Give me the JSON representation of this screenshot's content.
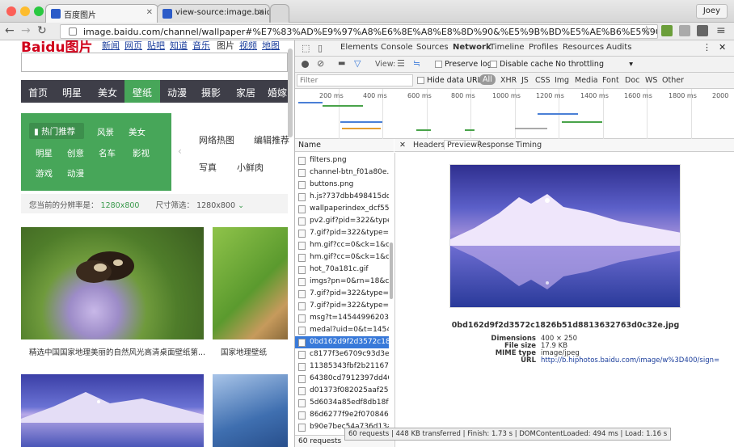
{
  "browser": {
    "tabs": [
      {
        "title": "百度图片"
      },
      {
        "title": "view-source:image.baidu.c"
      }
    ],
    "user_label": "Joey",
    "url": "image.baidu.com/channel/wallpaper#%E7%83%AD%E9%97%A8%E6%8E%A8%E8%8D%90&%E5%9B%BD%E5%AE%B6%E5%9C%B0%E7%90%86&..."
  },
  "page": {
    "logo": "Baidu图片",
    "top_links": [
      "新闻",
      "网页",
      "贴吧",
      "知道",
      "音乐",
      "图片",
      "视频",
      "地图"
    ],
    "categories": [
      "首页",
      "明星",
      "美女",
      "壁纸",
      "动漫",
      "摄影",
      "家居",
      "婚嫁"
    ],
    "active_category": "壁纸",
    "green_box": {
      "hot": "热门推荐",
      "items": [
        "风景",
        "美女",
        "明星",
        "创意",
        "名车",
        "影视",
        "游戏",
        "动漫"
      ]
    },
    "right_links": [
      "网络热图",
      "编辑推荐",
      "写真",
      "小鲜肉"
    ],
    "resolution_label": "您当前的分辨率是：",
    "resolution_value": "1280x800",
    "size_filter_label": "尺寸筛选：",
    "size_filter_value": "1280x800",
    "captions": [
      "精选中国国家地理美丽的自然风光高清桌面壁纸第...",
      "国家地理壁纸"
    ]
  },
  "devtools": {
    "tabs": [
      "Elements",
      "Console",
      "Sources",
      "Network",
      "Timeline",
      "Profiles",
      "Resources",
      "Audits"
    ],
    "active_tab": "Network",
    "toolbar": {
      "view_label": "View:",
      "preserve_log": "Preserve log",
      "disable_cache": "Disable cache",
      "throttling": "No throttling"
    },
    "filter": {
      "placeholder": "Filter",
      "hide_data_urls": "Hide data URLs",
      "types": [
        "All",
        "XHR",
        "JS",
        "CSS",
        "Img",
        "Media",
        "Font",
        "Doc",
        "WS",
        "Other"
      ]
    },
    "timeline_ticks": [
      "200 ms",
      "400 ms",
      "600 ms",
      "800 ms",
      "1000 ms",
      "1200 ms",
      "1400 ms",
      "1600 ms",
      "1800 ms",
      "2000"
    ],
    "name_header": "Name",
    "requests": [
      "filters.png",
      "channel-btn_f01a80e.png",
      "buttons.png",
      "h.js?737dbb498415dd39",
      "wallpaperindex_dcf55f0.j",
      "pv2.gif?pid=322&type=2",
      "7.gif?pid=322&type=201",
      "hm.gif?cc=0&ck=1&cl=2.",
      "hm.gif?cc=0&ck=1&cl=2.",
      "hot_70a181c.gif",
      "imgs?pn=0&rn=18&col=",
      "7.gif?pid=322&type=201",
      "7.gif?pid=322&type=201",
      "msg?t=1454499620313",
      "medal?uid=0&t=145449.",
      "0bd162d9f2d3572c1826",
      "c8177f3e6709c93d3ed5.",
      "11385343fbf2b2116724.",
      "64380cd7912397dd403.",
      "d01373f082025aaf25c8.",
      "5d6034a85edf8db18f55.",
      "86d6277f9e2f070846e1.",
      "b90e7bec54a736d13a14"
    ],
    "selected_request": "0bd162d9f2d3572c1826",
    "request_summary": "60 requests",
    "detail_tabs": [
      "Headers",
      "Preview",
      "Response",
      "Timing"
    ],
    "active_detail_tab": "Preview",
    "preview": {
      "filename": "0bd162d9f2d3572c1826b51d8813632763d0c32e.jpg",
      "meta": [
        {
          "key": "Dimensions",
          "value": "400 × 250"
        },
        {
          "key": "File size",
          "value": "17.9 KB"
        },
        {
          "key": "MIME type",
          "value": "image/jpeg"
        },
        {
          "key": "URL",
          "value": "http://b.hiphotos.baidu.com/image/w%3D400/sign="
        }
      ]
    },
    "status": "60 requests | 448 KB transferred | Finish: 1.73 s | DOMContentLoaded: 494 ms | Load: 1.16 s"
  }
}
